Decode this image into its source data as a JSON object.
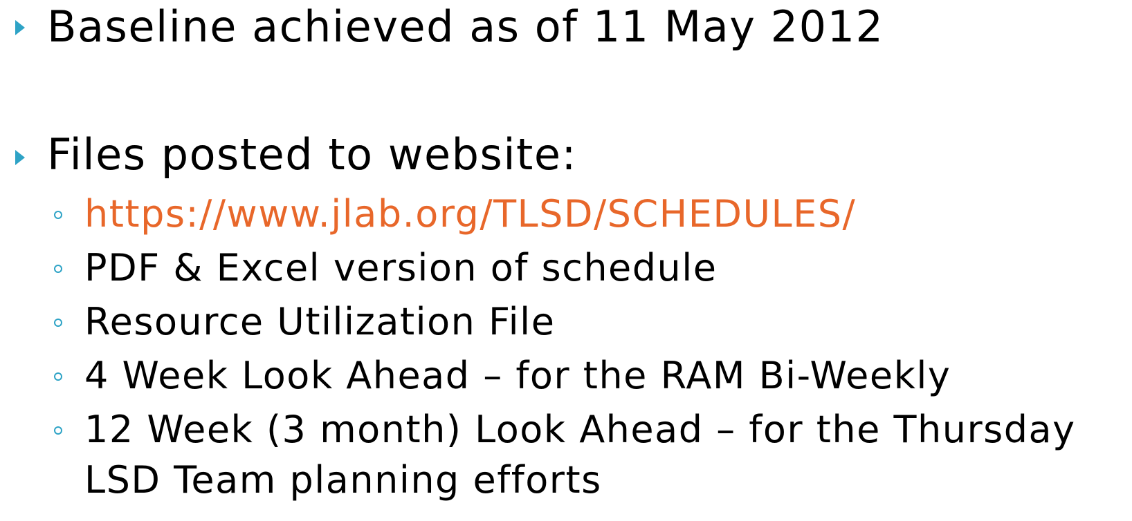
{
  "slide": {
    "bullets": [
      {
        "text": "Baseline achieved as of 11 May 2012"
      },
      {
        "text": "Files posted to website:",
        "subitems": [
          {
            "text": "https://www.jlab.org/TLSD/SCHEDULES/",
            "is_link": true
          },
          {
            "text": "PDF & Excel version of schedule"
          },
          {
            "text": "Resource Utilization File"
          },
          {
            "text": "4 Week Look Ahead – for the RAM Bi-Weekly"
          },
          {
            "text": "12 Week (3 month) Look Ahead – for the Thursday"
          },
          {
            "text": "LSD Team planning efforts"
          }
        ]
      }
    ],
    "colors": {
      "bullet": "#2ea3c6",
      "link": "#e8672a",
      "text": "#000000"
    }
  }
}
